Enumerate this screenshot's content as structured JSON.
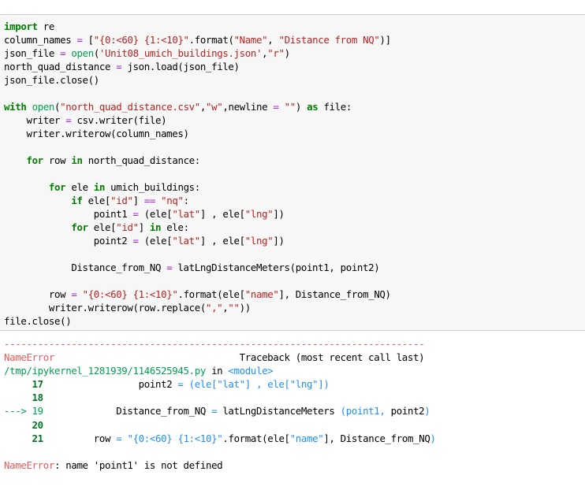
{
  "cell": {
    "code_lines": [
      [
        {
          "t": "import",
          "c": "kw"
        },
        {
          "t": " re"
        }
      ],
      [
        {
          "t": "column_names "
        },
        {
          "t": "=",
          "c": "op"
        },
        {
          "t": " ["
        },
        {
          "t": "\"{0:<60} {1:<10}\"",
          "c": "str"
        },
        {
          "t": ".format("
        },
        {
          "t": "\"Name\"",
          "c": "str"
        },
        {
          "t": ", "
        },
        {
          "t": "\"Distance from NQ\"",
          "c": "str"
        },
        {
          "t": ")]"
        }
      ],
      [
        {
          "t": "json_file "
        },
        {
          "t": "=",
          "c": "op"
        },
        {
          "t": " "
        },
        {
          "t": "open",
          "c": "green"
        },
        {
          "t": "("
        },
        {
          "t": "'Unit08_umich_buildings.json'",
          "c": "str"
        },
        {
          "t": ","
        },
        {
          "t": "\"r\"",
          "c": "str"
        },
        {
          "t": ")"
        }
      ],
      [
        {
          "t": "north_quad_distance "
        },
        {
          "t": "=",
          "c": "op"
        },
        {
          "t": " json.load(json_file)"
        }
      ],
      [
        {
          "t": "json_file.close()"
        }
      ],
      [
        {
          "t": ""
        }
      ],
      [
        {
          "t": "with",
          "c": "kw"
        },
        {
          "t": " "
        },
        {
          "t": "open",
          "c": "green"
        },
        {
          "t": "("
        },
        {
          "t": "\"north_quad_distance.csv\"",
          "c": "str"
        },
        {
          "t": ","
        },
        {
          "t": "\"w\"",
          "c": "str"
        },
        {
          "t": ",newline "
        },
        {
          "t": "=",
          "c": "op"
        },
        {
          "t": " "
        },
        {
          "t": "\"\"",
          "c": "str"
        },
        {
          "t": ") "
        },
        {
          "t": "as",
          "c": "kw"
        },
        {
          "t": " file:"
        }
      ],
      [
        {
          "t": "    writer "
        },
        {
          "t": "=",
          "c": "op"
        },
        {
          "t": " csv.writer(file)"
        }
      ],
      [
        {
          "t": "    writer.writerow(column_names)"
        }
      ],
      [
        {
          "t": ""
        }
      ],
      [
        {
          "t": "    "
        },
        {
          "t": "for",
          "c": "kw"
        },
        {
          "t": " row "
        },
        {
          "t": "in",
          "c": "kw"
        },
        {
          "t": " north_quad_distance:"
        }
      ],
      [
        {
          "t": ""
        }
      ],
      [
        {
          "t": "        "
        },
        {
          "t": "for",
          "c": "kw"
        },
        {
          "t": " ele "
        },
        {
          "t": "in",
          "c": "kw"
        },
        {
          "t": " umich_buildings:"
        }
      ],
      [
        {
          "t": "            "
        },
        {
          "t": "if",
          "c": "kw"
        },
        {
          "t": " ele["
        },
        {
          "t": "\"id\"",
          "c": "str"
        },
        {
          "t": "] "
        },
        {
          "t": "==",
          "c": "op"
        },
        {
          "t": " "
        },
        {
          "t": "\"nq\"",
          "c": "str"
        },
        {
          "t": ":"
        }
      ],
      [
        {
          "t": "                point1 "
        },
        {
          "t": "=",
          "c": "op"
        },
        {
          "t": " (ele["
        },
        {
          "t": "\"lat\"",
          "c": "str"
        },
        {
          "t": "] , ele["
        },
        {
          "t": "\"lng\"",
          "c": "str"
        },
        {
          "t": "])"
        }
      ],
      [
        {
          "t": "            "
        },
        {
          "t": "for",
          "c": "kw"
        },
        {
          "t": " ele["
        },
        {
          "t": "\"id\"",
          "c": "str"
        },
        {
          "t": "] "
        },
        {
          "t": "in",
          "c": "kw"
        },
        {
          "t": " ele:"
        }
      ],
      [
        {
          "t": "                point2 "
        },
        {
          "t": "=",
          "c": "op"
        },
        {
          "t": " (ele["
        },
        {
          "t": "\"lat\"",
          "c": "str"
        },
        {
          "t": "] , ele["
        },
        {
          "t": "\"lng\"",
          "c": "str"
        },
        {
          "t": "])"
        }
      ],
      [
        {
          "t": ""
        }
      ],
      [
        {
          "t": "            Distance_from_NQ "
        },
        {
          "t": "=",
          "c": "op"
        },
        {
          "t": " latLngDistanceMeters(point1, point2)"
        }
      ],
      [
        {
          "t": ""
        }
      ],
      [
        {
          "t": "        row "
        },
        {
          "t": "=",
          "c": "op"
        },
        {
          "t": " "
        },
        {
          "t": "\"{0:<60} {1:<10}\"",
          "c": "str"
        },
        {
          "t": ".format(ele["
        },
        {
          "t": "\"name\"",
          "c": "str"
        },
        {
          "t": "], Distance_from_NQ)"
        }
      ],
      [
        {
          "t": "        writer.writerow(row.replace("
        },
        {
          "t": "\",\"",
          "c": "str"
        },
        {
          "t": ","
        },
        {
          "t": "\"\"",
          "c": "str"
        },
        {
          "t": "))"
        }
      ],
      [
        {
          "t": "file.close()"
        }
      ]
    ]
  },
  "output": {
    "lines": [
      [
        {
          "t": "---------------------------------------------------------------------------",
          "c": "red"
        }
      ],
      [
        {
          "t": "NameError",
          "c": "red"
        },
        {
          "t": "                                 Traceback (most recent call last)"
        }
      ],
      [
        {
          "t": "/tmp/ipykernel_1281939/1146525945.py",
          "c": "green"
        },
        {
          "t": " in "
        },
        {
          "t": "<module>",
          "c": "cyan"
        }
      ],
      [
        {
          "t": "     17",
          "c": "dgreen"
        },
        {
          "t": "                 point2 "
        },
        {
          "t": "= (ele[",
          "c": "blue"
        },
        {
          "t": "\"lat\"",
          "c": "blue"
        },
        {
          "t": "] , ele[",
          "c": "blue"
        },
        {
          "t": "\"lng\"",
          "c": "blue"
        },
        {
          "t": "])",
          "c": "blue"
        }
      ],
      [
        {
          "t": "     18",
          "c": "dgreen"
        }
      ],
      [
        {
          "t": "---> 19",
          "c": "green"
        },
        {
          "t": "             Distance_from_NQ "
        },
        {
          "t": "=",
          "c": "blue"
        },
        {
          "t": " latLngDistanceMeters "
        },
        {
          "t": "(point1, ",
          "c": "blue"
        },
        {
          "t": "point2"
        },
        {
          "t": ")",
          "c": "blue"
        }
      ],
      [
        {
          "t": "     20",
          "c": "dgreen"
        }
      ],
      [
        {
          "t": "     21",
          "c": "dgreen"
        },
        {
          "t": "         row "
        },
        {
          "t": "=",
          "c": "blue"
        },
        {
          "t": " "
        },
        {
          "t": "\"{0:<60} {1:<10}\"",
          "c": "blue"
        },
        {
          "t": ".format(ele["
        },
        {
          "t": "\"name\"",
          "c": "blue"
        },
        {
          "t": "], Distance_from_NQ"
        },
        {
          "t": ")",
          "c": "blue"
        }
      ],
      [
        {
          "t": ""
        }
      ],
      [
        {
          "t": "NameError",
          "c": "red"
        },
        {
          "t": ": name 'point1' is not defined"
        }
      ]
    ]
  }
}
